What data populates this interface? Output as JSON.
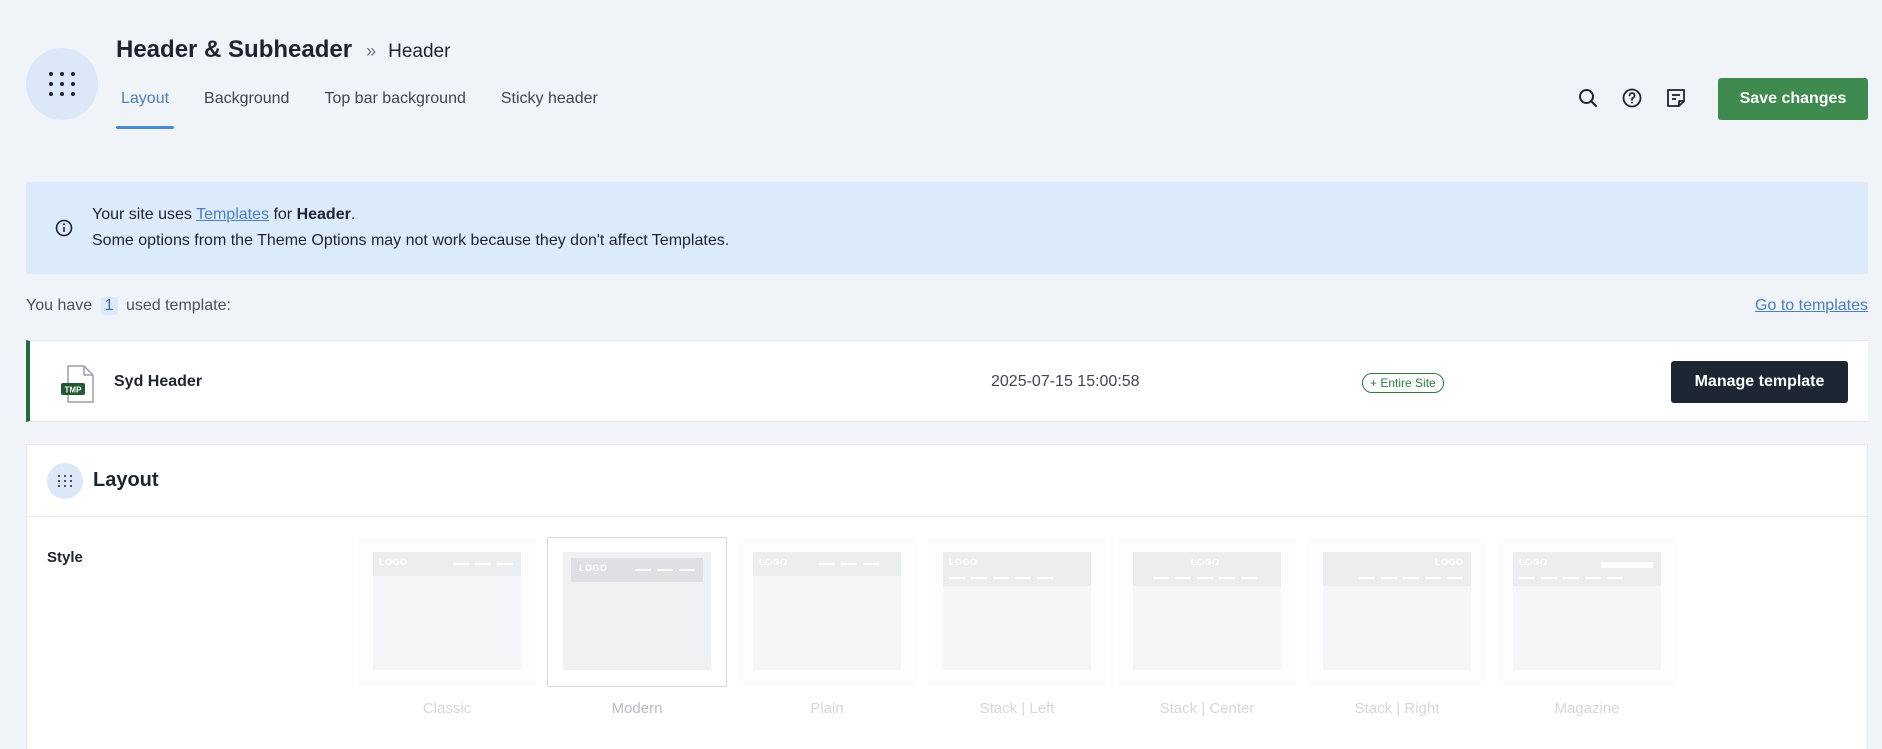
{
  "header": {
    "title": "Header & Subheader",
    "breadcrumb_sep": "»",
    "breadcrumb_current": "Header",
    "tabs": [
      {
        "label": "Layout",
        "active": true
      },
      {
        "label": "Background",
        "active": false
      },
      {
        "label": "Top bar background",
        "active": false
      },
      {
        "label": "Sticky header",
        "active": false
      }
    ],
    "tools": [
      "search-icon",
      "help-icon",
      "notes-icon"
    ],
    "save_label": "Save changes"
  },
  "notice": {
    "prefix": "Your site uses ",
    "link": "Templates",
    "middle": " for ",
    "bold": "Header",
    "suffix": ".",
    "line2": "Some options from the Theme Options may not work because they don't affect Templates."
  },
  "templates": {
    "used_prefix": "You have",
    "count": "1",
    "used_suffix": "used template:",
    "goto_label": "Go to templates",
    "item": {
      "icon_label": "TMP",
      "name": "Syd Header",
      "date": "2025-07-15 15:00:58",
      "scope": "+ Entire Site",
      "manage_label": "Manage template"
    }
  },
  "layout": {
    "title": "Layout",
    "style_label": "Style",
    "thumb_logo": "LOGO",
    "options": [
      {
        "name": "Classic",
        "selected": false
      },
      {
        "name": "Modern",
        "selected": true
      },
      {
        "name": "Plain",
        "selected": false
      },
      {
        "name": "Stack | Left",
        "selected": false
      },
      {
        "name": "Stack | Center",
        "selected": false
      },
      {
        "name": "Stack | Right",
        "selected": false
      },
      {
        "name": "Magazine",
        "selected": false
      }
    ]
  },
  "colors": {
    "accent": "#4a7fc1",
    "save": "#3f8b4f",
    "template_border": "#1f6b3a",
    "notice_bg": "#dcebfb"
  }
}
